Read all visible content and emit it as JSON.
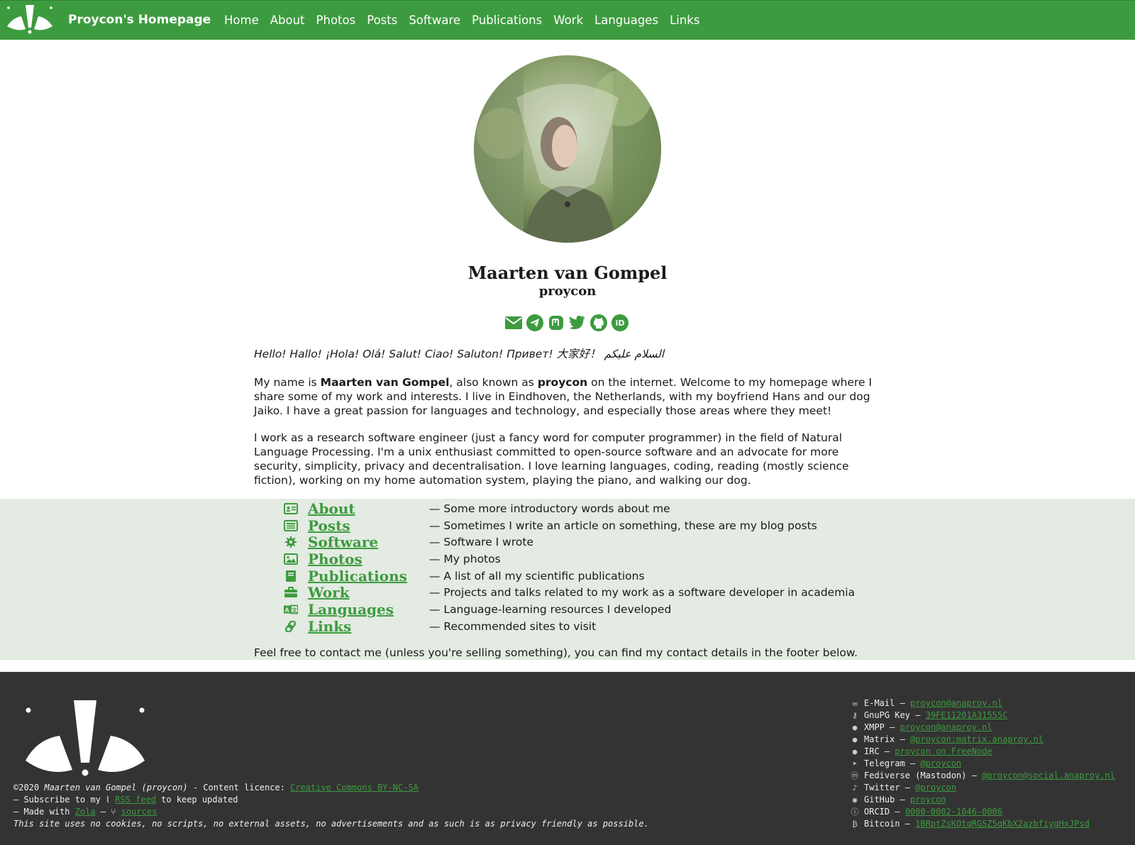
{
  "nav": {
    "title": "Proycon's Homepage",
    "links": [
      "Home",
      "About",
      "Photos",
      "Posts",
      "Software",
      "Publications",
      "Work",
      "Languages",
      "Links"
    ]
  },
  "profile": {
    "name": "Maarten van Gompel",
    "handle": "proycon",
    "social_icons": [
      "email-icon",
      "telegram-icon",
      "mastodon-icon",
      "twitter-icon",
      "github-icon",
      "orcid-icon"
    ]
  },
  "intro": {
    "greeting": "Hello! Hallo! ¡Hola! Olá! Salut! Ciao! Saluton! Привет! 大家好！ السلام عليكم",
    "p1_before": "My name is ",
    "p1_name": "Maarten van Gompel",
    "p1_mid": ", also known as ",
    "p1_handle": "proycon",
    "p1_after": " on the internet. Welcome to my homepage where I share some of my work and interests. I live in Eindhoven, the Netherlands, with my boyfriend Hans and our dog Jaiko. I have a great passion for languages and technology, and especially those areas where they meet!",
    "p2": "I work as a research software engineer (just a fancy word for computer programmer) in the field of Natural Language Processing. I'm a unix enthusiast committed to open-source software and an advocate for more security, simplicity, privacy and decentralisation. I love learning languages, coding, reading (mostly science fiction), working on my home automation system, playing the piano, and walking our dog."
  },
  "sections": [
    {
      "label": "About",
      "desc": "— Some more introductory words about me",
      "icon": "id-card-icon"
    },
    {
      "label": "Posts",
      "desc": "— Sometimes I write an article on something, these are my blog posts",
      "icon": "newspaper-icon"
    },
    {
      "label": "Software",
      "desc": "— Software I wrote",
      "icon": "gear-icon"
    },
    {
      "label": "Photos",
      "desc": "— My photos",
      "icon": "image-icon"
    },
    {
      "label": "Publications",
      "desc": "— A list of all my scientific publications",
      "icon": "book-icon"
    },
    {
      "label": "Work",
      "desc": "— Projects and talks related to my work as a software developer in academia",
      "icon": "briefcase-icon"
    },
    {
      "label": "Languages",
      "desc": "— Language-learning resources I developed",
      "icon": "language-icon"
    },
    {
      "label": "Links",
      "desc": "— Recommended sites to visit",
      "icon": "link-icon"
    }
  ],
  "contact_note": "Feel free to contact me (unless you're selling something), you can find my contact details in the footer below.",
  "footer": {
    "copyright_prefix": "©2020 ",
    "copyright_name": "Maarten van Gompel (proycon)",
    "licence_label": " - Content licence: ",
    "licence_link": "Creative Commons BY-NC-SA",
    "subscribe_prefix": "– Subscribe to my ",
    "rss_link": "RSS feed",
    "subscribe_suffix": " to keep updated",
    "made_prefix": "– Made with ",
    "zola_link": "Zola",
    "made_sep": " – ",
    "sources_link": "sources",
    "privacy": "This site uses no cookies, no scripts, no external assets, no advertisements and as such is as privacy friendly as possible.",
    "contacts": [
      {
        "label": "E-Mail",
        "value": "proycon@anaproy.nl",
        "icon": "email-icon"
      },
      {
        "label": "GnuPG Key",
        "value": "39FE11201A31555C",
        "icon": "key-icon"
      },
      {
        "label": "XMPP",
        "value": "proycon@anaproy.nl",
        "icon": "chat-icon"
      },
      {
        "label": "Matrix",
        "value": "@proycon:matrix.anaproy.nl",
        "icon": "chat-icon"
      },
      {
        "label": "IRC",
        "value": "proycon on FreeNode",
        "icon": "chat-icon"
      },
      {
        "label": "Telegram",
        "value": "@proycon",
        "icon": "telegram-icon"
      },
      {
        "label": "Fediverse (Mastodon)",
        "value": "@proycon@social.anaproy.nl",
        "icon": "mastodon-icon"
      },
      {
        "label": "Twitter",
        "value": "@proycon",
        "icon": "twitter-icon"
      },
      {
        "label": "GitHub",
        "value": "proycon",
        "icon": "github-icon"
      },
      {
        "label": "ORCID",
        "value": "0000-0002-1046-0006",
        "icon": "orcid-icon"
      },
      {
        "label": "Bitcoin",
        "value": "1BRptZsKQtqRGSZ5qKbX2azbfiygHxJPsd",
        "icon": "bitcoin-icon"
      }
    ]
  },
  "colors": {
    "brand_green": "#3d9b3f",
    "list_band": "#e3ebe2",
    "footer_bg": "#333333"
  }
}
